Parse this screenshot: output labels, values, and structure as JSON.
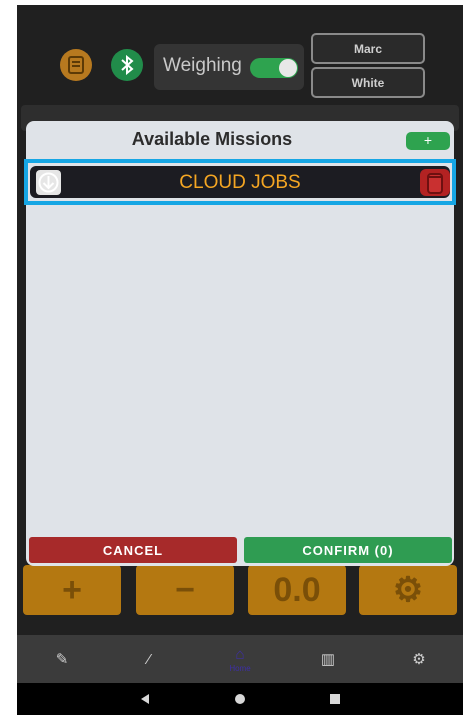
{
  "header": {
    "weighing_label": "Weighing",
    "weighing_enabled": true,
    "user_first_name": "Marc",
    "user_last_name": "White"
  },
  "modal": {
    "title": "Available Missions",
    "add_label": "+",
    "missions": [
      {
        "name": "CLOUD JOBS"
      }
    ],
    "cancel_label": "CANCEL",
    "confirm_label": "CONFIRM (0)"
  },
  "background_tiles": [
    "+",
    "−",
    "0.0",
    "⚙"
  ],
  "navbar": {
    "items": [
      {
        "icon": "pencil-icon",
        "label": ""
      },
      {
        "icon": "wand-icon",
        "label": ""
      },
      {
        "icon": "home-icon",
        "label": "Home",
        "active": true
      },
      {
        "icon": "chart-icon",
        "label": ""
      },
      {
        "icon": "gear-icon",
        "label": ""
      }
    ]
  },
  "colors": {
    "accent_orange": "#f5a623",
    "confirm_green": "#2f9c52",
    "cancel_red": "#a72a2a",
    "highlight_blue": "#16a6e4",
    "nav_active": "#3d2fa6"
  }
}
